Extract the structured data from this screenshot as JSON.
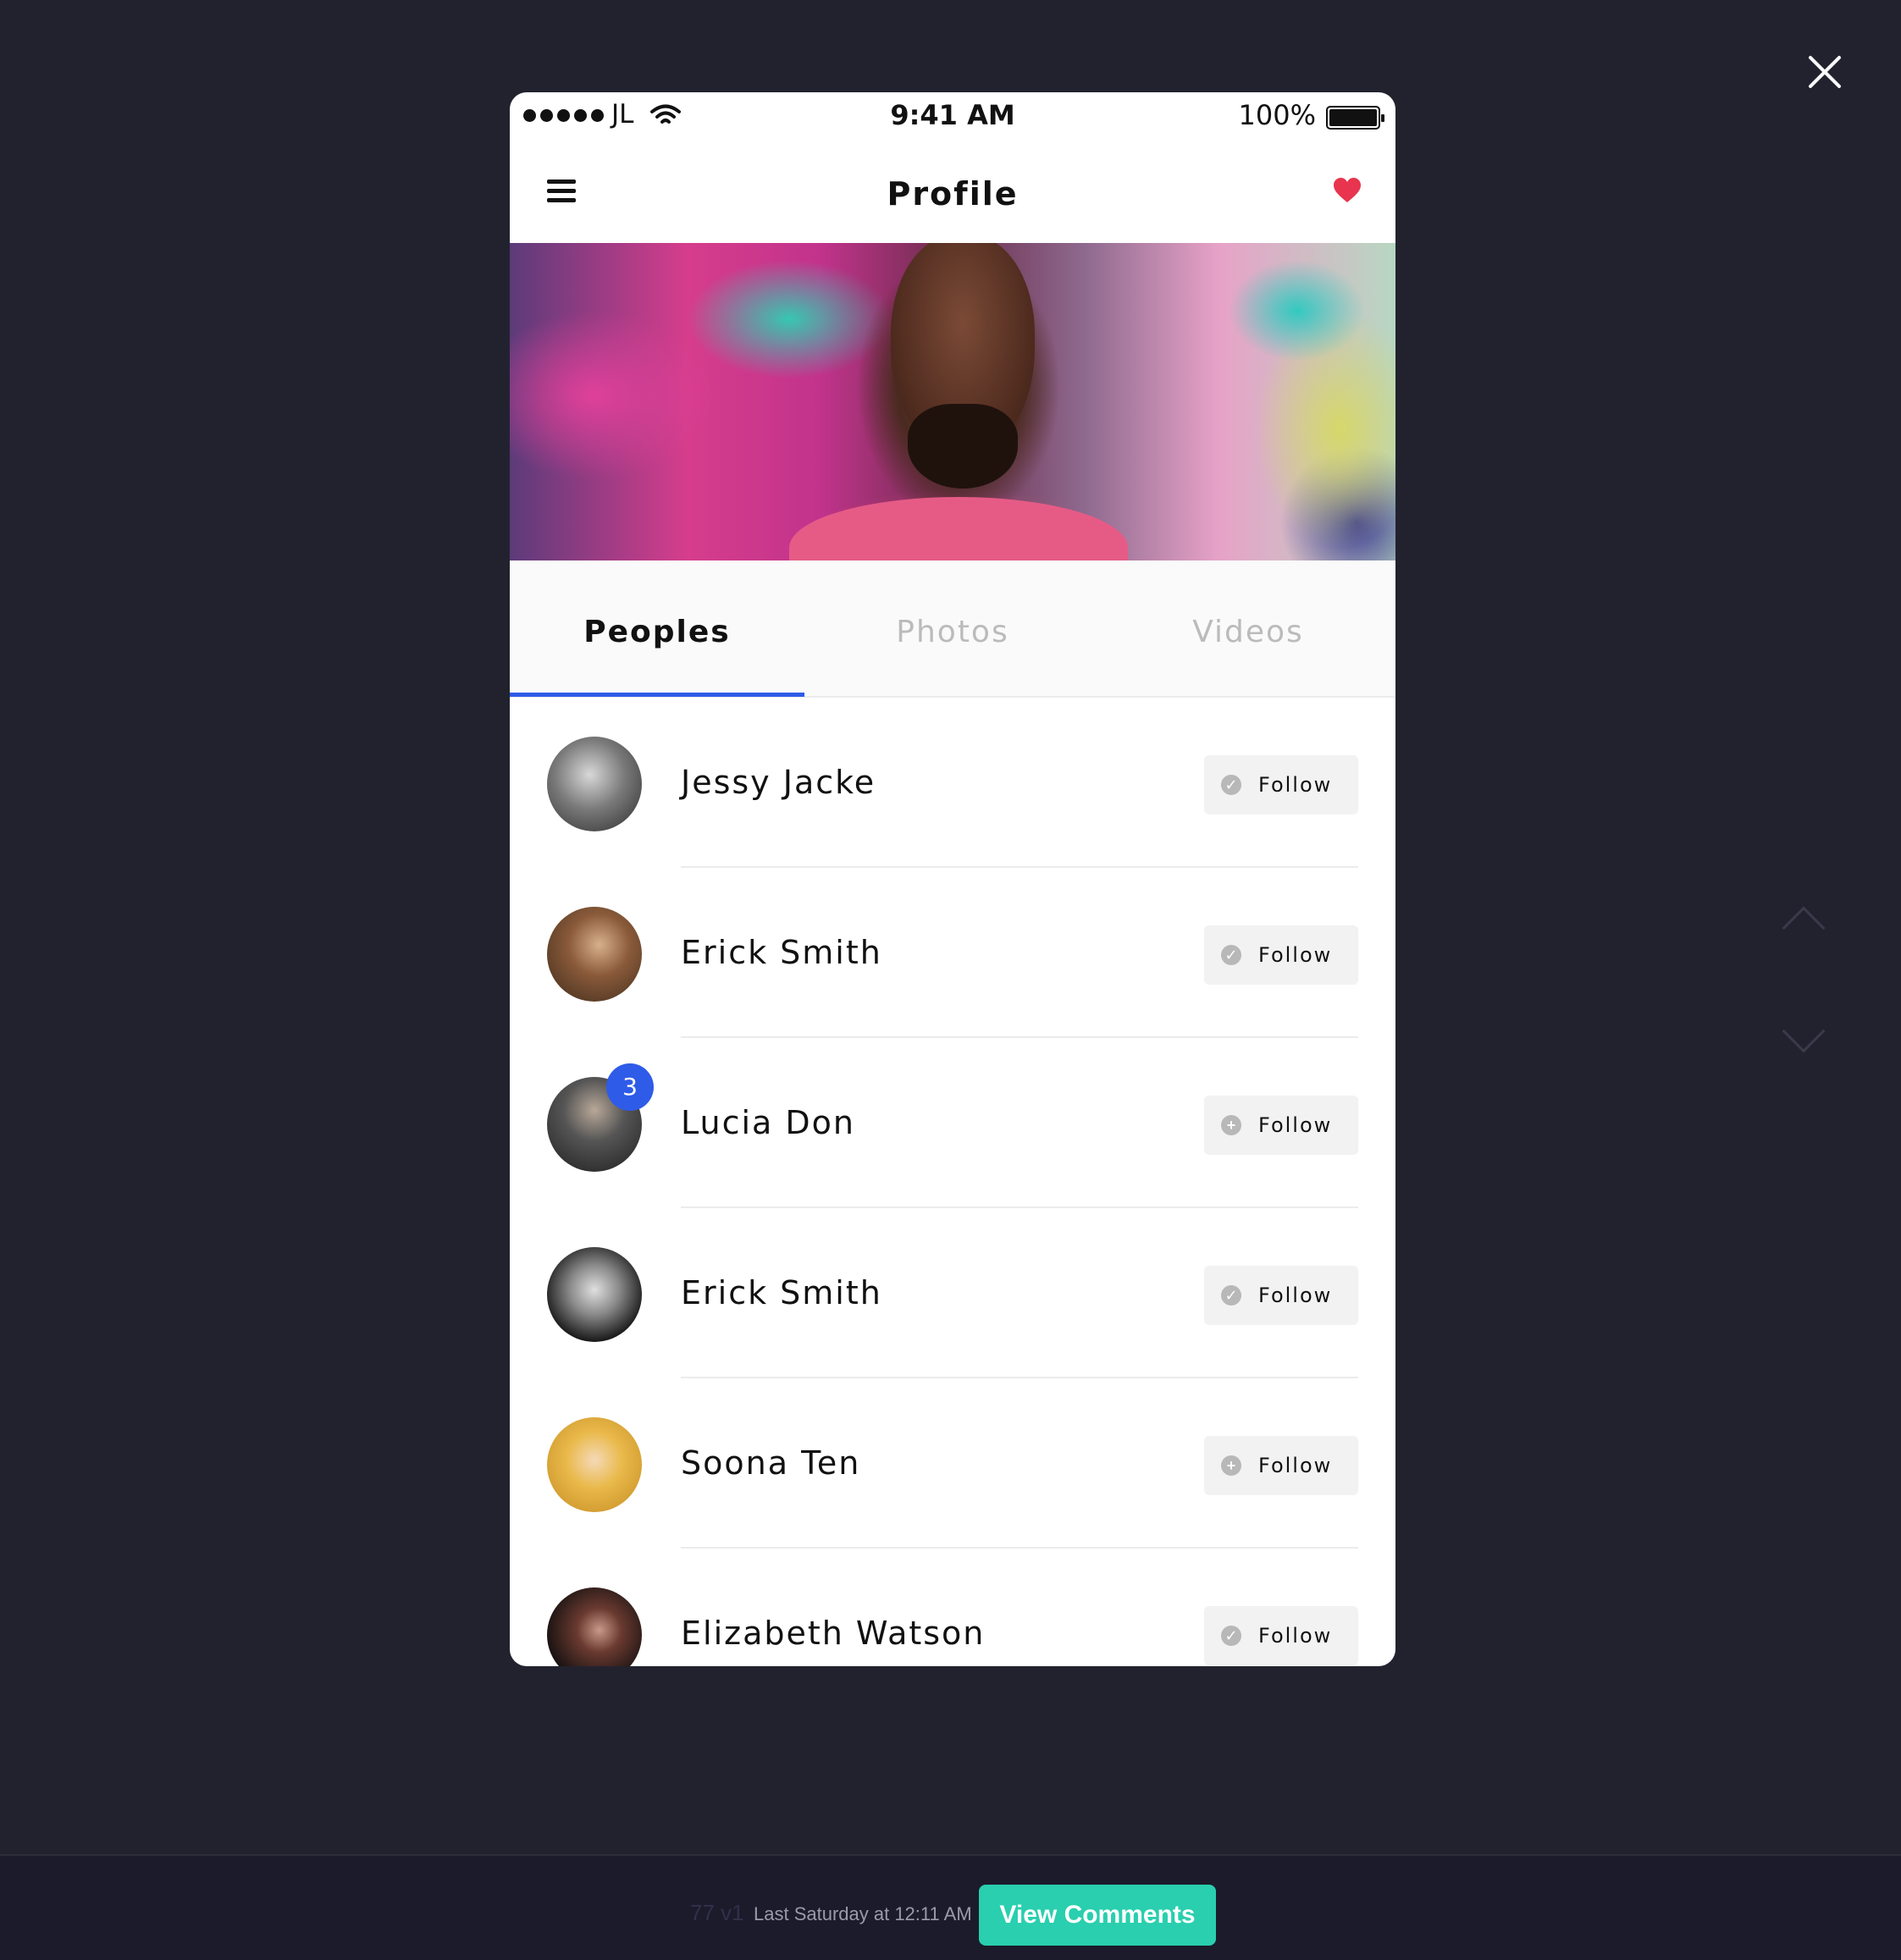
{
  "status_bar": {
    "carrier": "JL",
    "time": "9:41 AM",
    "battery": "100%"
  },
  "header": {
    "title": "Profile"
  },
  "tabs": [
    {
      "label": "Peoples",
      "active": true
    },
    {
      "label": "Photos",
      "active": false
    },
    {
      "label": "Videos",
      "active": false
    }
  ],
  "people": [
    {
      "name": "Jessy Jacke",
      "follow_label": "Follow",
      "follow_state": "check",
      "avatar_color": "#6a6a6a"
    },
    {
      "name": "Erick Smith",
      "follow_label": "Follow",
      "follow_state": "check",
      "avatar_color": "#6b4a2e"
    },
    {
      "name": "Lucia Don",
      "follow_label": "Follow",
      "follow_state": "plus",
      "badge": "3",
      "avatar_color": "#3a3a3a"
    },
    {
      "name": "Erick Smith",
      "follow_label": "Follow",
      "follow_state": "check",
      "avatar_color": "#2a2a2a"
    },
    {
      "name": "Soona Ten",
      "follow_label": "Follow",
      "follow_state": "plus",
      "avatar_color": "#e2b43a"
    },
    {
      "name": "Elizabeth Watson",
      "follow_label": "Follow",
      "follow_state": "check",
      "avatar_color": "#1e1a1a"
    }
  ],
  "footer": {
    "version": "77 v1",
    "timestamp": "Last Saturday at 12:11 AM",
    "view_comments": "View Comments"
  },
  "colors": {
    "accent": "#2e5be8",
    "heart": "#e8344e",
    "comments_button": "#29cfae",
    "background": "#22222f"
  }
}
